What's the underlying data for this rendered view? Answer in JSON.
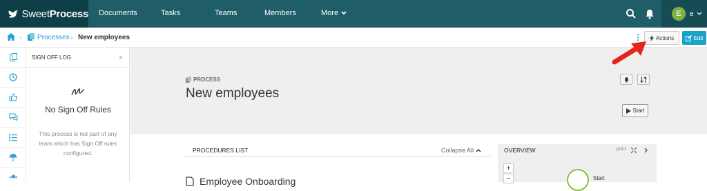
{
  "app": {
    "brand_part1": "Sweet",
    "brand_part2": "Process"
  },
  "nav": {
    "documents": "Documents",
    "tasks": "Tasks",
    "teams": "Teams",
    "members": "Members",
    "more": "More"
  },
  "user": {
    "initial": "E",
    "name": "e"
  },
  "breadcrumb": {
    "processes": "Processes",
    "current": "New employees",
    "separator": "›"
  },
  "toolbar": {
    "actions_label": "Actions",
    "edit_label": "Edit",
    "more_label": "⋮"
  },
  "signoff": {
    "header": "SIGN OFF LOG",
    "close": "×",
    "empty_title": "No Sign Off Rules",
    "empty_text": "This process is not part of any team which has Sign Off rules configured."
  },
  "process": {
    "label": "PROCESS",
    "title": "New employees",
    "start_label": "Start"
  },
  "procedures": {
    "header": "PROCEDURES LIST",
    "collapse_label": "Collapse All",
    "first_item": "Employee Onboarding"
  },
  "overview": {
    "header": "OVERVIEW",
    "print_label": "print",
    "zoom_in": "+",
    "zoom_out": "−",
    "node_label": "Start"
  },
  "colors": {
    "topbar": "#1f5e68",
    "accent": "#2a9fd6",
    "edit_button": "#18a3c9",
    "annotation_arrow": "#e8231a"
  }
}
